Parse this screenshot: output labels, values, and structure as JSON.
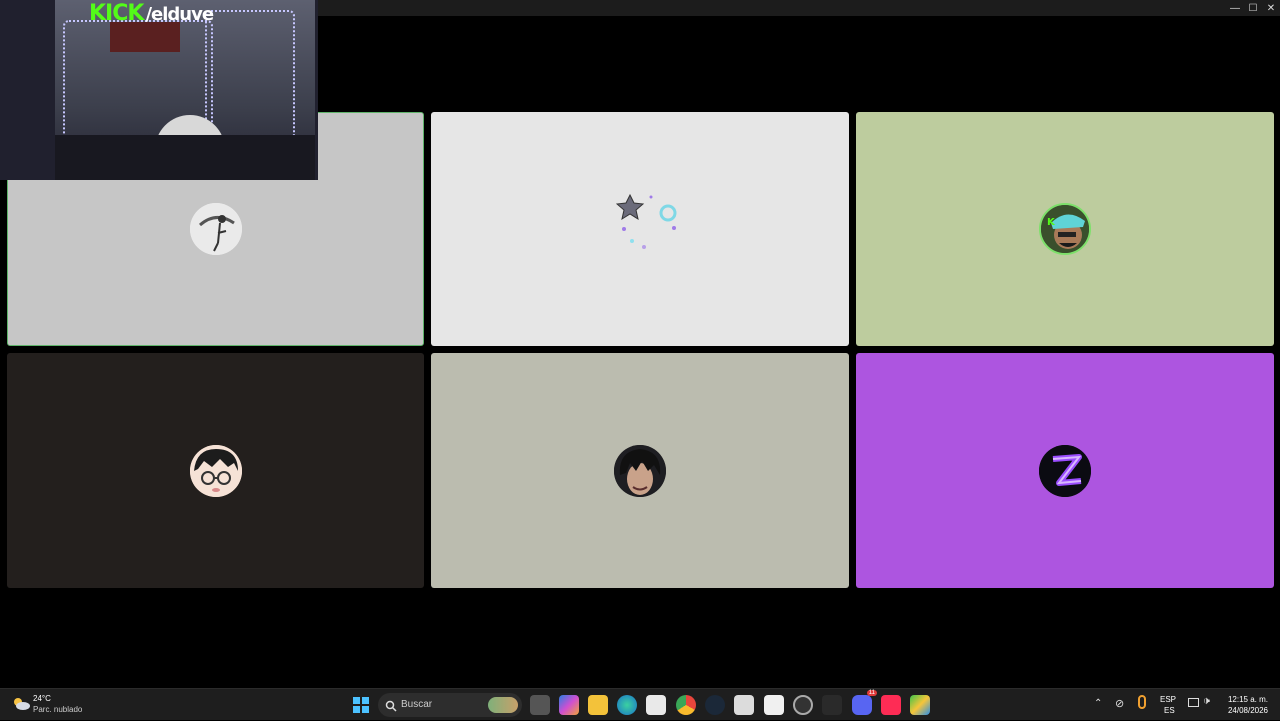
{
  "window": {
    "controls": {
      "minimize": "—",
      "maximize": "☐",
      "close": "✕"
    }
  },
  "stream_overlay": {
    "brand": "KICK",
    "handle": "/elduve"
  },
  "participants": [
    {
      "tile_color": "#c6c6c6",
      "avatar": "photo-character-avatar",
      "active_speaker": true
    },
    {
      "tile_color": "#e6e6e6",
      "avatar": "stars-sketch-avatar",
      "active_speaker": false
    },
    {
      "tile_color": "#bdcc9e",
      "avatar": "green-character-avatar",
      "active_speaker": false
    },
    {
      "tile_color": "#231f1d",
      "avatar": "glasses-anime-avatar",
      "active_speaker": false
    },
    {
      "tile_color": "#bbbcaf",
      "avatar": "dark-hair-anime-avatar",
      "active_speaker": false
    },
    {
      "tile_color": "#ad55e0",
      "avatar": "z-logo-avatar",
      "active_speaker": false
    }
  ],
  "colors": {
    "active_border": "#5fb46a",
    "accent": "#53fc18"
  },
  "taskbar": {
    "weather_temp": "24°C",
    "weather_desc": "Parc. nublado",
    "search_placeholder": "Buscar",
    "apps": [
      "start-icon",
      "task-view-icon",
      "m365-icon",
      "file-explorer-icon",
      "edge-icon",
      "store-icon",
      "chrome-icon",
      "steam-icon",
      "notepad-icon",
      "capcut-icon",
      "app-icon",
      "epic-games-icon",
      "discord-icon",
      "tiktok-icon",
      "bluestacks-icon"
    ],
    "discord_badge": "11",
    "lang_top": "ESP",
    "lang_bottom": "ES",
    "time": "12:15 a. m.",
    "date": "24/08/2026"
  }
}
